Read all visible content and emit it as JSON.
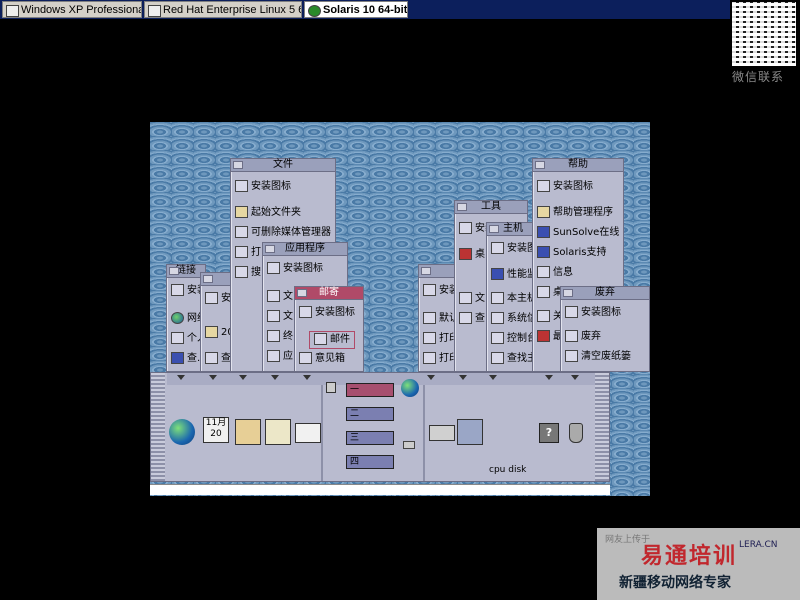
{
  "host_tabs": [
    {
      "label": "Windows XP Professional",
      "active": false
    },
    {
      "label": "Red Hat Enterprise Linux 5 6...",
      "active": false
    },
    {
      "label": "Solaris 10 64-bit",
      "active": true
    }
  ],
  "watermark": {
    "qr_caption": "微信联系",
    "brand_top": "网友上传于",
    "brand_main": "易通培训",
    "brand_url": "LERA.CN",
    "brand_sub": "新疆移动网络专家"
  },
  "panels": {
    "file": {
      "title": "文件",
      "items": [
        "安装图标",
        "起始文件夹",
        "可删除媒体管理器",
        "打..",
        "搜..."
      ]
    },
    "apps": {
      "title": "应用程序",
      "items": [
        "安装图标",
        "文...",
        "文...",
        "终..",
        "应..."
      ]
    },
    "mail": {
      "title": "邮寄",
      "items": [
        "安装图标",
        "邮件",
        "意见箱"
      ]
    },
    "links": {
      "title": "链接",
      "items": [
        "安装",
        "网络",
        "个人",
        "查..."
      ]
    },
    "cards": {
      "items": [
        "安装",
        "20",
        "查..."
      ]
    },
    "tools": {
      "title": "工具",
      "items": [
        "安装",
        "桌...",
        "文..",
        "查..."
      ]
    },
    "hosts": {
      "title": "主机",
      "items": [
        "安装图标",
        "性能监视",
        "本主机",
        "系统信息",
        "控制台",
        "查找主机"
      ]
    },
    "printers": {
      "items": [
        "安装",
        "默认",
        "打印",
        "打印"
      ]
    },
    "help": {
      "title": "帮助",
      "items": [
        "安装图标",
        "帮助管理程序",
        "SunSolve在线",
        "Solaris支持",
        "信息",
        "桌...",
        "关..",
        "最..."
      ]
    },
    "trash": {
      "title": "废弃",
      "items": [
        "安装图标",
        "废弃",
        "清空废纸篓"
      ]
    }
  },
  "front_panel": {
    "calendar_month": "11月",
    "calendar_day": "20",
    "workspaces": [
      "一",
      "二",
      "三",
      "四"
    ],
    "active_workspace": 0,
    "cpu_disk_label": "cpu disk",
    "help_glyph": "?"
  }
}
